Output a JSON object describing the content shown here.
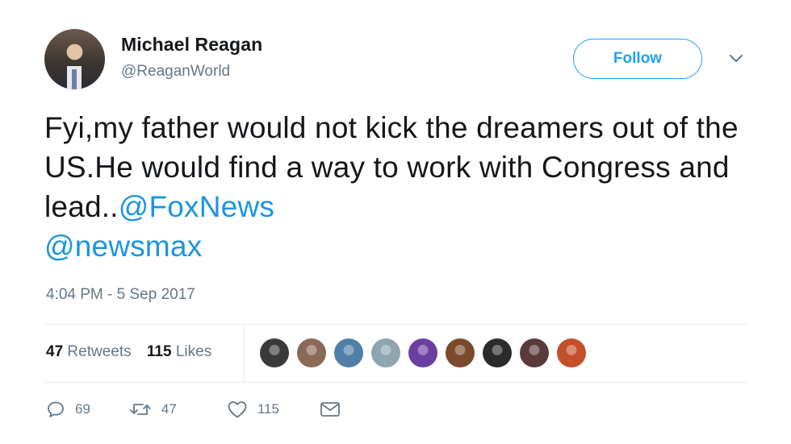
{
  "user": {
    "display_name": "Michael Reagan",
    "handle": "@ReaganWorld"
  },
  "follow_button": {
    "label": "Follow"
  },
  "tweet": {
    "text_segments": [
      "Fyi,my father would not kick the dreamers out of the US.He would find a way to work with Congress and lead..",
      "@FoxNews",
      "@newsmax"
    ],
    "timestamp": "4:04 PM - 5 Sep 2017"
  },
  "stats": {
    "retweets_count": "47",
    "retweets_label": "Retweets",
    "likes_count": "115",
    "likes_label": "Likes"
  },
  "likers": [
    {
      "name": "liker-avatar-1",
      "color": "#3a3a3a"
    },
    {
      "name": "liker-avatar-2",
      "color": "#8a6a55"
    },
    {
      "name": "liker-avatar-3",
      "color": "#4f7fa8"
    },
    {
      "name": "liker-avatar-4",
      "color": "#8fa6b0"
    },
    {
      "name": "liker-avatar-5",
      "color": "#6b3fa0"
    },
    {
      "name": "liker-avatar-6",
      "color": "#7a4a2a"
    },
    {
      "name": "liker-avatar-7",
      "color": "#2b2b2b"
    },
    {
      "name": "liker-avatar-8",
      "color": "#5a3a3a"
    },
    {
      "name": "liker-avatar-9",
      "color": "#c4502a"
    }
  ],
  "actions": {
    "reply_count": "69",
    "retweet_count": "47",
    "like_count": "115"
  },
  "colors": {
    "accent": "#1da1f2",
    "mention": "#1b95e0",
    "muted": "#657786",
    "text": "#14171a"
  }
}
